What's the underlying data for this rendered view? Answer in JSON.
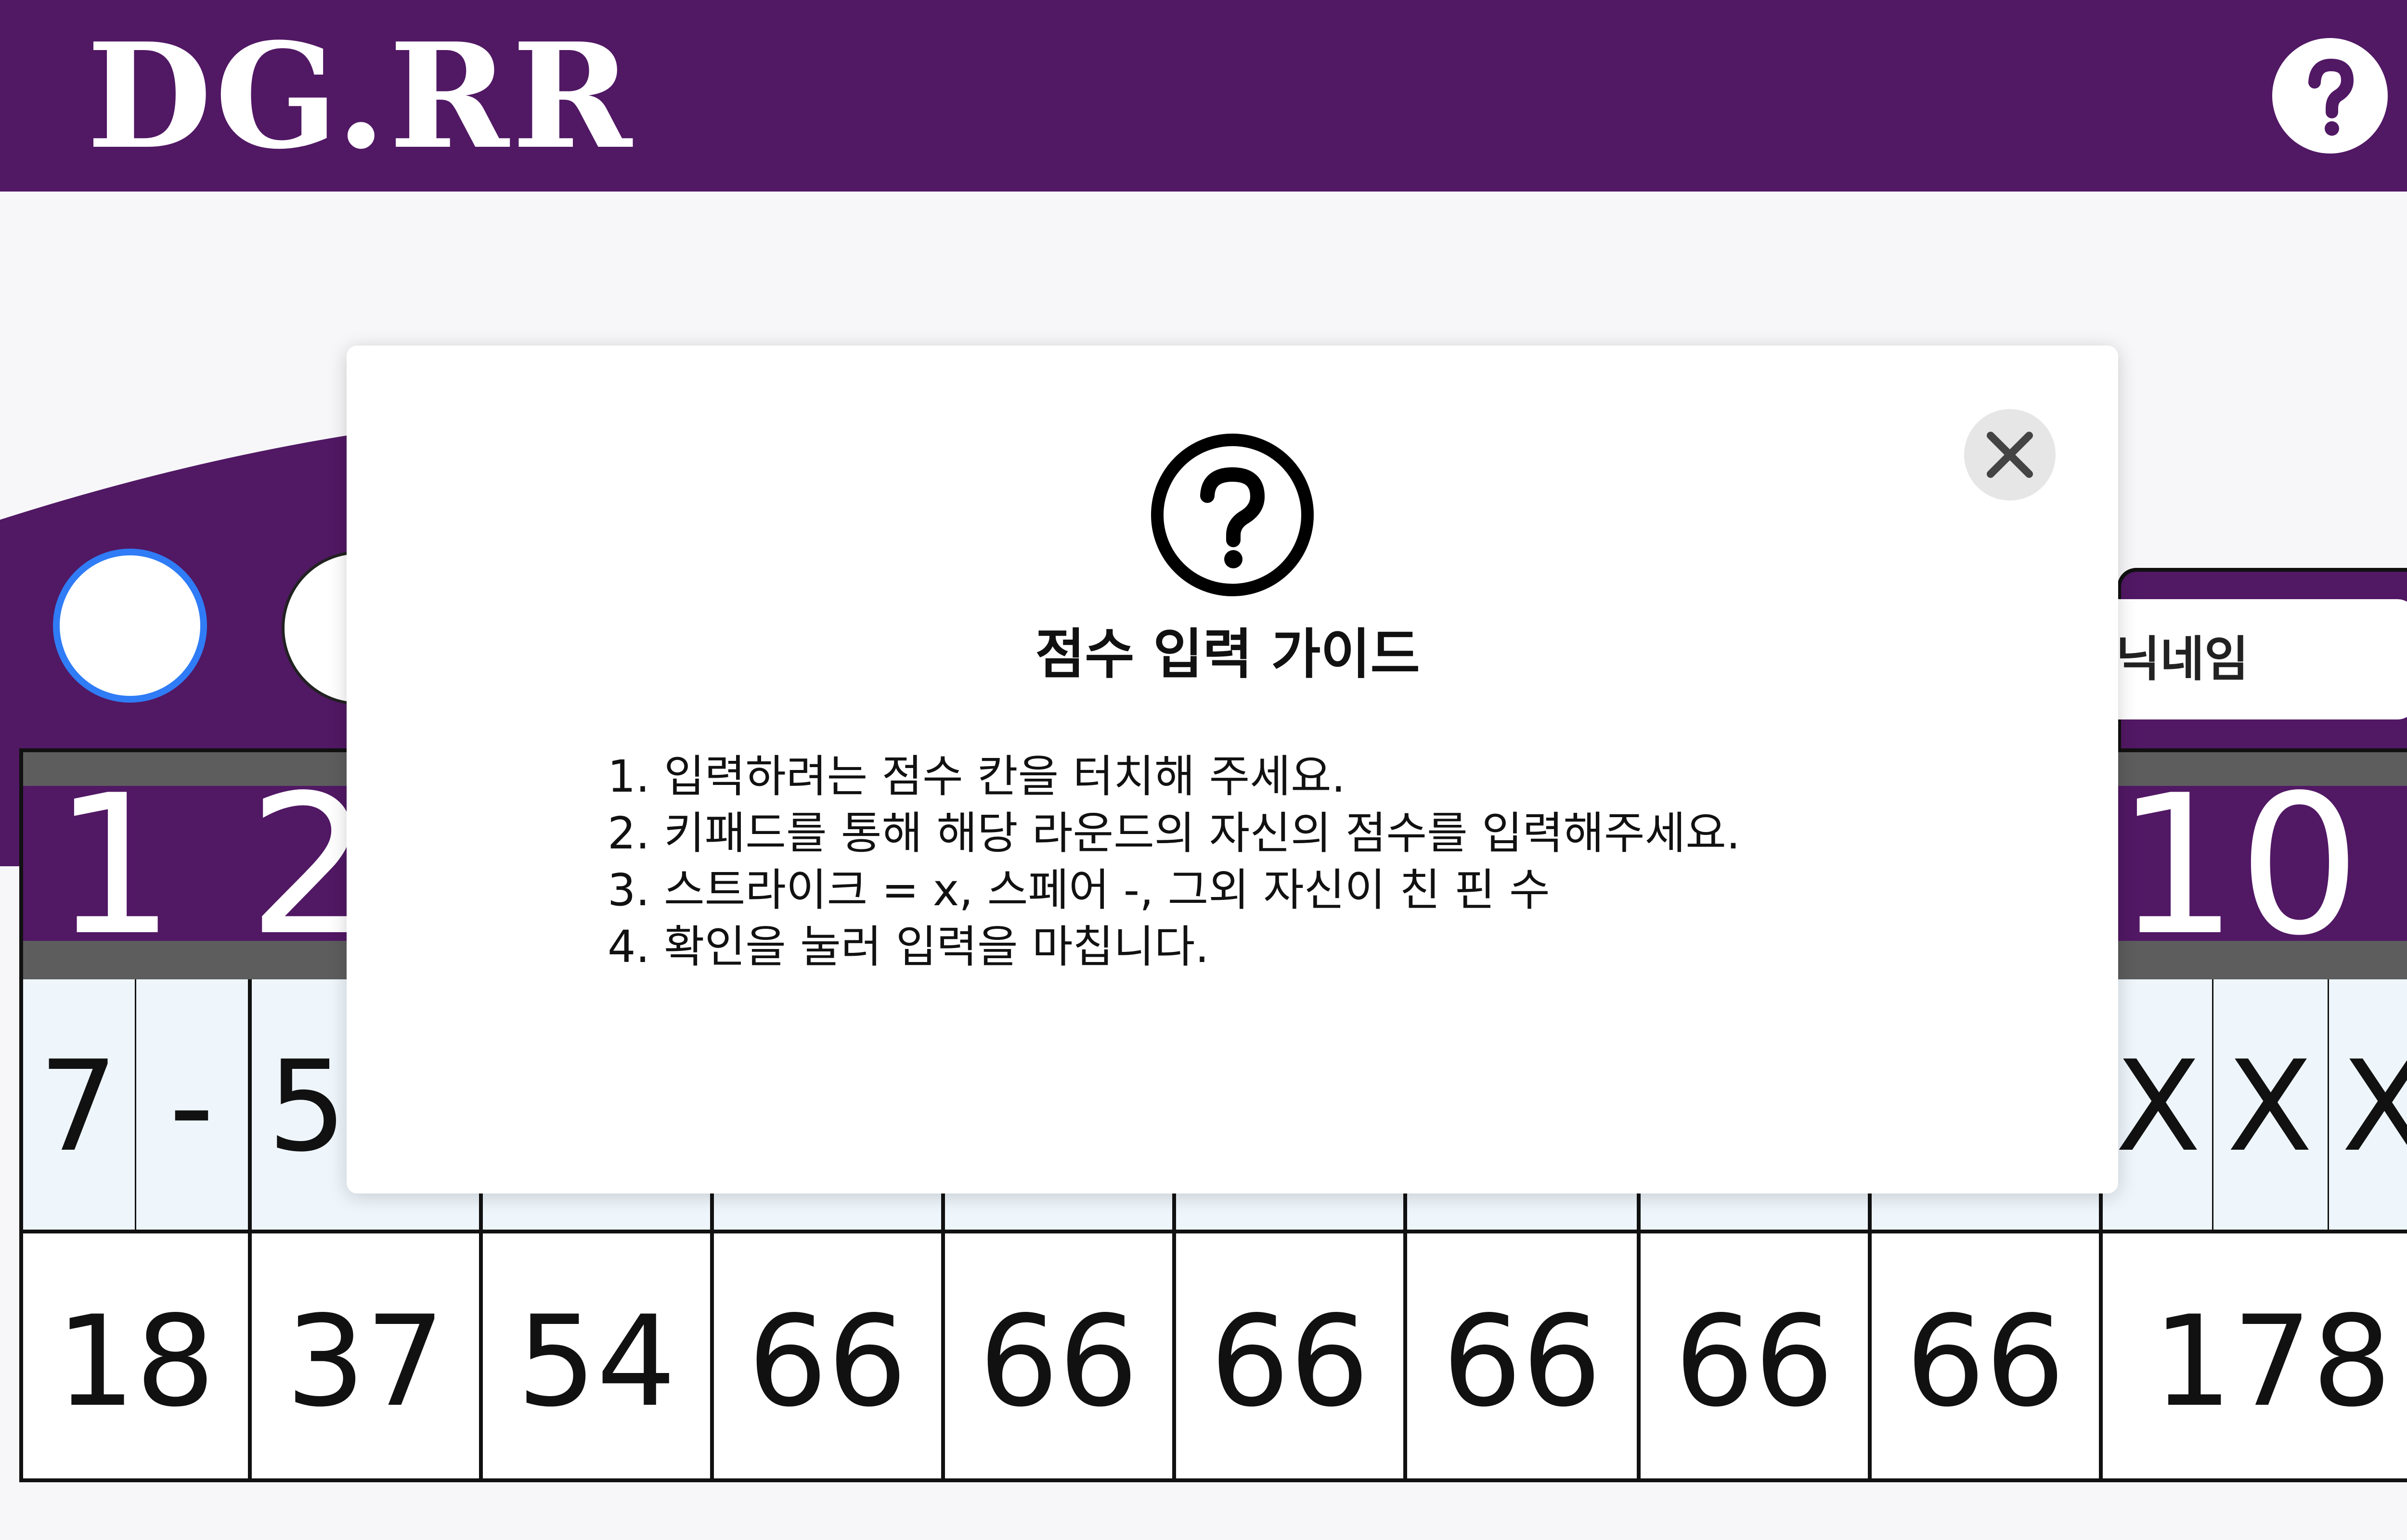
{
  "app": {
    "logo": "DG.RR"
  },
  "header": {
    "help_icon": "question-mark-icon"
  },
  "players": [
    {
      "selected": true
    },
    {
      "selected": false
    }
  ],
  "nickname": {
    "label": "닉네임"
  },
  "frames": [
    "1",
    "2",
    "10"
  ],
  "rolls": {
    "frame1": [
      "7",
      "-"
    ],
    "frame2": [
      "5"
    ],
    "frame10": [
      "X",
      "X",
      "X"
    ]
  },
  "totals": [
    "18",
    "37",
    "54",
    "66",
    "66",
    "66",
    "66",
    "66",
    "66",
    "178"
  ],
  "modal": {
    "title": "점수 입력 가이드",
    "icon": "question-circle-icon",
    "close_icon": "close-icon",
    "steps": [
      "1. 입력하려는 점수 칸을 터치해 주세요.",
      "2. 키패드를 통해 해당 라운드의 자신의 점수를 입력해주세요.",
      "3. 스트라이크 = x, 스페어 -, 그외 자신이 친 핀 수",
      "4. 확인을 눌러 입력을 마칩니다."
    ]
  },
  "colors": {
    "brand_purple": "#511864",
    "band_gray": "#5d5d5d",
    "selected_ring": "#2f7cf6",
    "roll_bg": "#eef6fc"
  }
}
